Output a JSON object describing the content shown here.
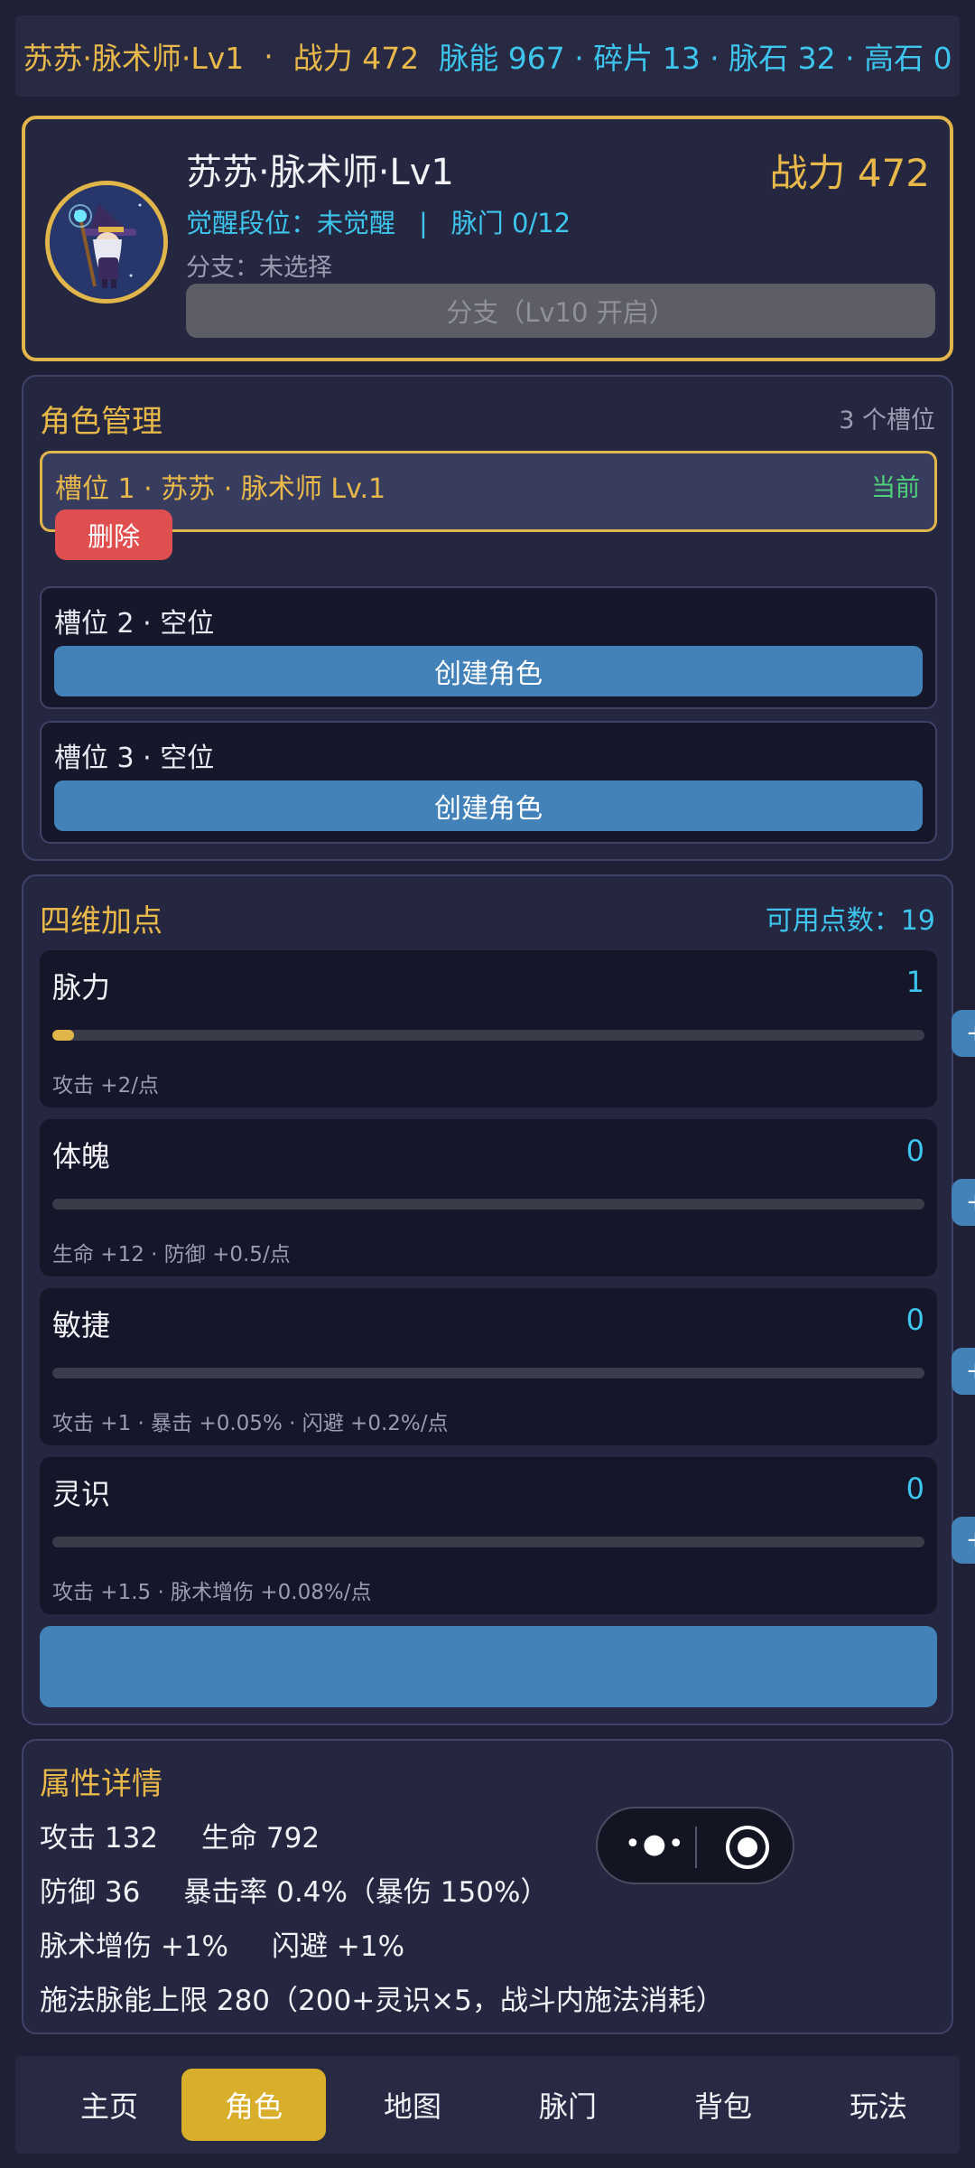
{
  "topbar": {
    "name": "苏苏·脉术师·Lv1",
    "sep1": "·",
    "power": "战力 472",
    "resources": "脉能 967 · 碎片 13 · 脉石 32 · 高石 0"
  },
  "profile": {
    "name": "苏苏·脉术师·Lv1",
    "power": "战力 472",
    "awake": "觉醒段位：未觉醒",
    "divider": "|",
    "meridian": "脉门 0/12",
    "branch": "分支：未选择",
    "branch_button": "分支（Lv10 开启）"
  },
  "roles": {
    "title": "角色管理",
    "slot_count": "3 个槽位",
    "slots": [
      {
        "label": "槽位 1 · 苏苏 · 脉术师 Lv.1",
        "tag": "当前",
        "button": "删除"
      },
      {
        "label": "槽位 2 · 空位",
        "button": "创建角色"
      },
      {
        "label": "槽位 3 · 空位",
        "button": "创建角色"
      }
    ]
  },
  "stats": {
    "title": "四维加点",
    "available": "可用点数：19",
    "plus": "+",
    "items": [
      {
        "name": "脉力",
        "value": "1",
        "level": 0.025,
        "desc": "攻击 +2/点"
      },
      {
        "name": "体魄",
        "value": "0",
        "level": 0,
        "desc": "生命 +12 · 防御 +0.5/点"
      },
      {
        "name": "敏捷",
        "value": "0",
        "level": 0,
        "desc": "攻击 +1 · 暴击 +0.05% · 闪避 +0.2%/点"
      },
      {
        "name": "灵识",
        "value": "0",
        "level": 0,
        "desc": "攻击 +1.5 · 脉术增伤 +0.08%/点"
      }
    ]
  },
  "attrs": {
    "title": "属性详情",
    "attack": "攻击 132",
    "hp": "生命 792",
    "defense": "防御 36",
    "crit": "暴击率 0.4%（暴伤 150%）",
    "spell": "脉术增伤 +1%",
    "dodge": "闪避 +1%",
    "energy": "施法脉能上限 280（200+灵识×5，战斗内施法消耗）"
  },
  "nav": [
    "主页",
    "角色",
    "地图",
    "脉门",
    "背包",
    "玩法"
  ],
  "nav_active": 1,
  "colors": {
    "accent": "#e0b54a",
    "info": "#3ec5ee",
    "button": "#4282b8",
    "danger": "#df4f4f",
    "success": "#4fd17a"
  }
}
